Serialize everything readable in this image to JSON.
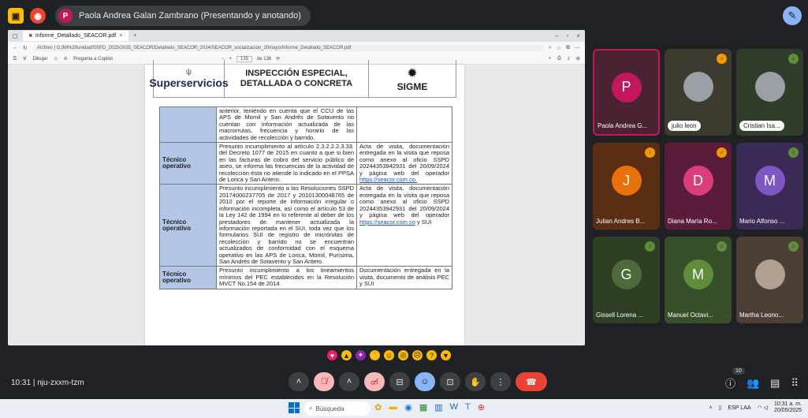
{
  "topbar": {
    "presenter_initial": "P",
    "presenter_text": "Paola Andrea Galan Zambrano (Presentando y anotando)"
  },
  "browser": {
    "tab_title": "Informe_Detallado_SEACOR.pdf",
    "url": "Archivo | G:/Mi%20unidad/SSPD_2025/2025_SEACOR/Detallado_SEACOR_2024/SEACOR_socializacion_20mayo/Informe_Detallado_SEACOR.pdf",
    "pdf_toolbar": {
      "draw_label": "Dibujar",
      "copilot_label": "Pregunta a Copilot",
      "page_current": "135",
      "page_total": "de 136"
    }
  },
  "document": {
    "header": {
      "brand": "Superservicios",
      "title": "INSPECCIÓN ESPECIAL, DETALLADA O CONCRETA",
      "seal_text": "SIGME"
    },
    "rows": [
      {
        "label": "",
        "description": "anterior, teniendo en cuenta que el CCU de las APS de Momil y San Andrés de Sotavento no cuentan con información actualizada de las macrorrutas, frecuencia y horario de las actividades de recolección y barrido.",
        "evidence": "",
        "link": "",
        "suffix": ""
      },
      {
        "label": "Técnico operativo",
        "description": "Presunto incumplimiento al artículo 2.3.2.2.2.3.33. del Decreto 1077 de 2015 en cuanto a que si bien en las facturas de cobro del servicio público de aseo, se informa las frecuencias de la actividad de recolección ésta no atiende lo indicado en el PPSA de Lorica y San Antero.",
        "evidence": "Acta de visita, documentación entregada en la visita que reposa como anexo al oficio SSPD 20244353942931 del 20/09/2024 y página web del operador ",
        "link": "https://seacor.com.co.",
        "suffix": ""
      },
      {
        "label": "Técnico operativo",
        "description": "Presunto incumplimiento a las Resoluciones SSPD 20174000237705 de 2017 y 20101300048765 de 2010 por el reporte de información irregular o información incompleta, así como el artículo 53 de la Ley 142 de 1994 en lo referente al deber de los prestadores de mantener actualizada la información reportada en el SUI, toda vez que los formularios SUI de registro de micrórutas de recolección y barrido no se encuentran actualizados de conformidad con el esquema operativo en las APS de Lorica, Momil, Purísima, San Andrés de Sotavento y San Antero.",
        "evidence": "Acta de visita, documentación entregada en la visita que reposa como anexo al oficio SSPD 20244353942931 del 20/09/2024 y página web del operador ",
        "link": "https://seacor.com.co",
        "suffix": " y SUI"
      },
      {
        "label": "Técnico operativo",
        "description": "Presunto incumplimiento a los lineamientos mínimos del PEC establecidos en la Resolución MVCT No.154 de 2014",
        "evidence": "Documentación entregada en la visita, documento de análisis PEC y SUI",
        "link": "",
        "suffix": ""
      }
    ]
  },
  "participants": [
    {
      "name": "Paola Andrea G...",
      "initial": "P",
      "color": "#c2185b",
      "bg": "#4a2232",
      "mic": ""
    },
    {
      "name": "julio leon",
      "initial": "",
      "color": "#9aa0a6",
      "bg": "#3d3b30",
      "mic": "orange"
    },
    {
      "name": "Cristian Isa...",
      "initial": "",
      "color": "#9aa0a6",
      "bg": "#2f3d2a",
      "mic": "green"
    },
    {
      "name": "Julian Andres B...",
      "initial": "J",
      "color": "#e8710a",
      "bg": "#5a2e12",
      "mic": "orange"
    },
    {
      "name": "Diana María Ro...",
      "initial": "D",
      "color": "#d93d7a",
      "bg": "#5b1c3a",
      "mic": "orange"
    },
    {
      "name": "Mario Alfonso ...",
      "initial": "M",
      "color": "#7e57c2",
      "bg": "#3a2a56",
      "mic": "green"
    },
    {
      "name": "Gissell Lorena ...",
      "initial": "G",
      "color": "#4d6b3a",
      "bg": "#2e3f24",
      "mic": "green"
    },
    {
      "name": "Manuel Octavi...",
      "initial": "M",
      "color": "#5f8d3b",
      "bg": "#37502a",
      "mic": "green"
    },
    {
      "name": "Martha Leono...",
      "initial": "",
      "color": "#b0a090",
      "bg": "#4d3f36",
      "mic": "green"
    }
  ],
  "meeting": {
    "time": "10:31",
    "code": "nju-zxxm-tzm",
    "people_count": "10"
  },
  "taskbar": {
    "search_placeholder": "Búsqueda",
    "lang": "ESP LAA",
    "time": "10:31 a. m.",
    "date": "20/05/2025"
  }
}
